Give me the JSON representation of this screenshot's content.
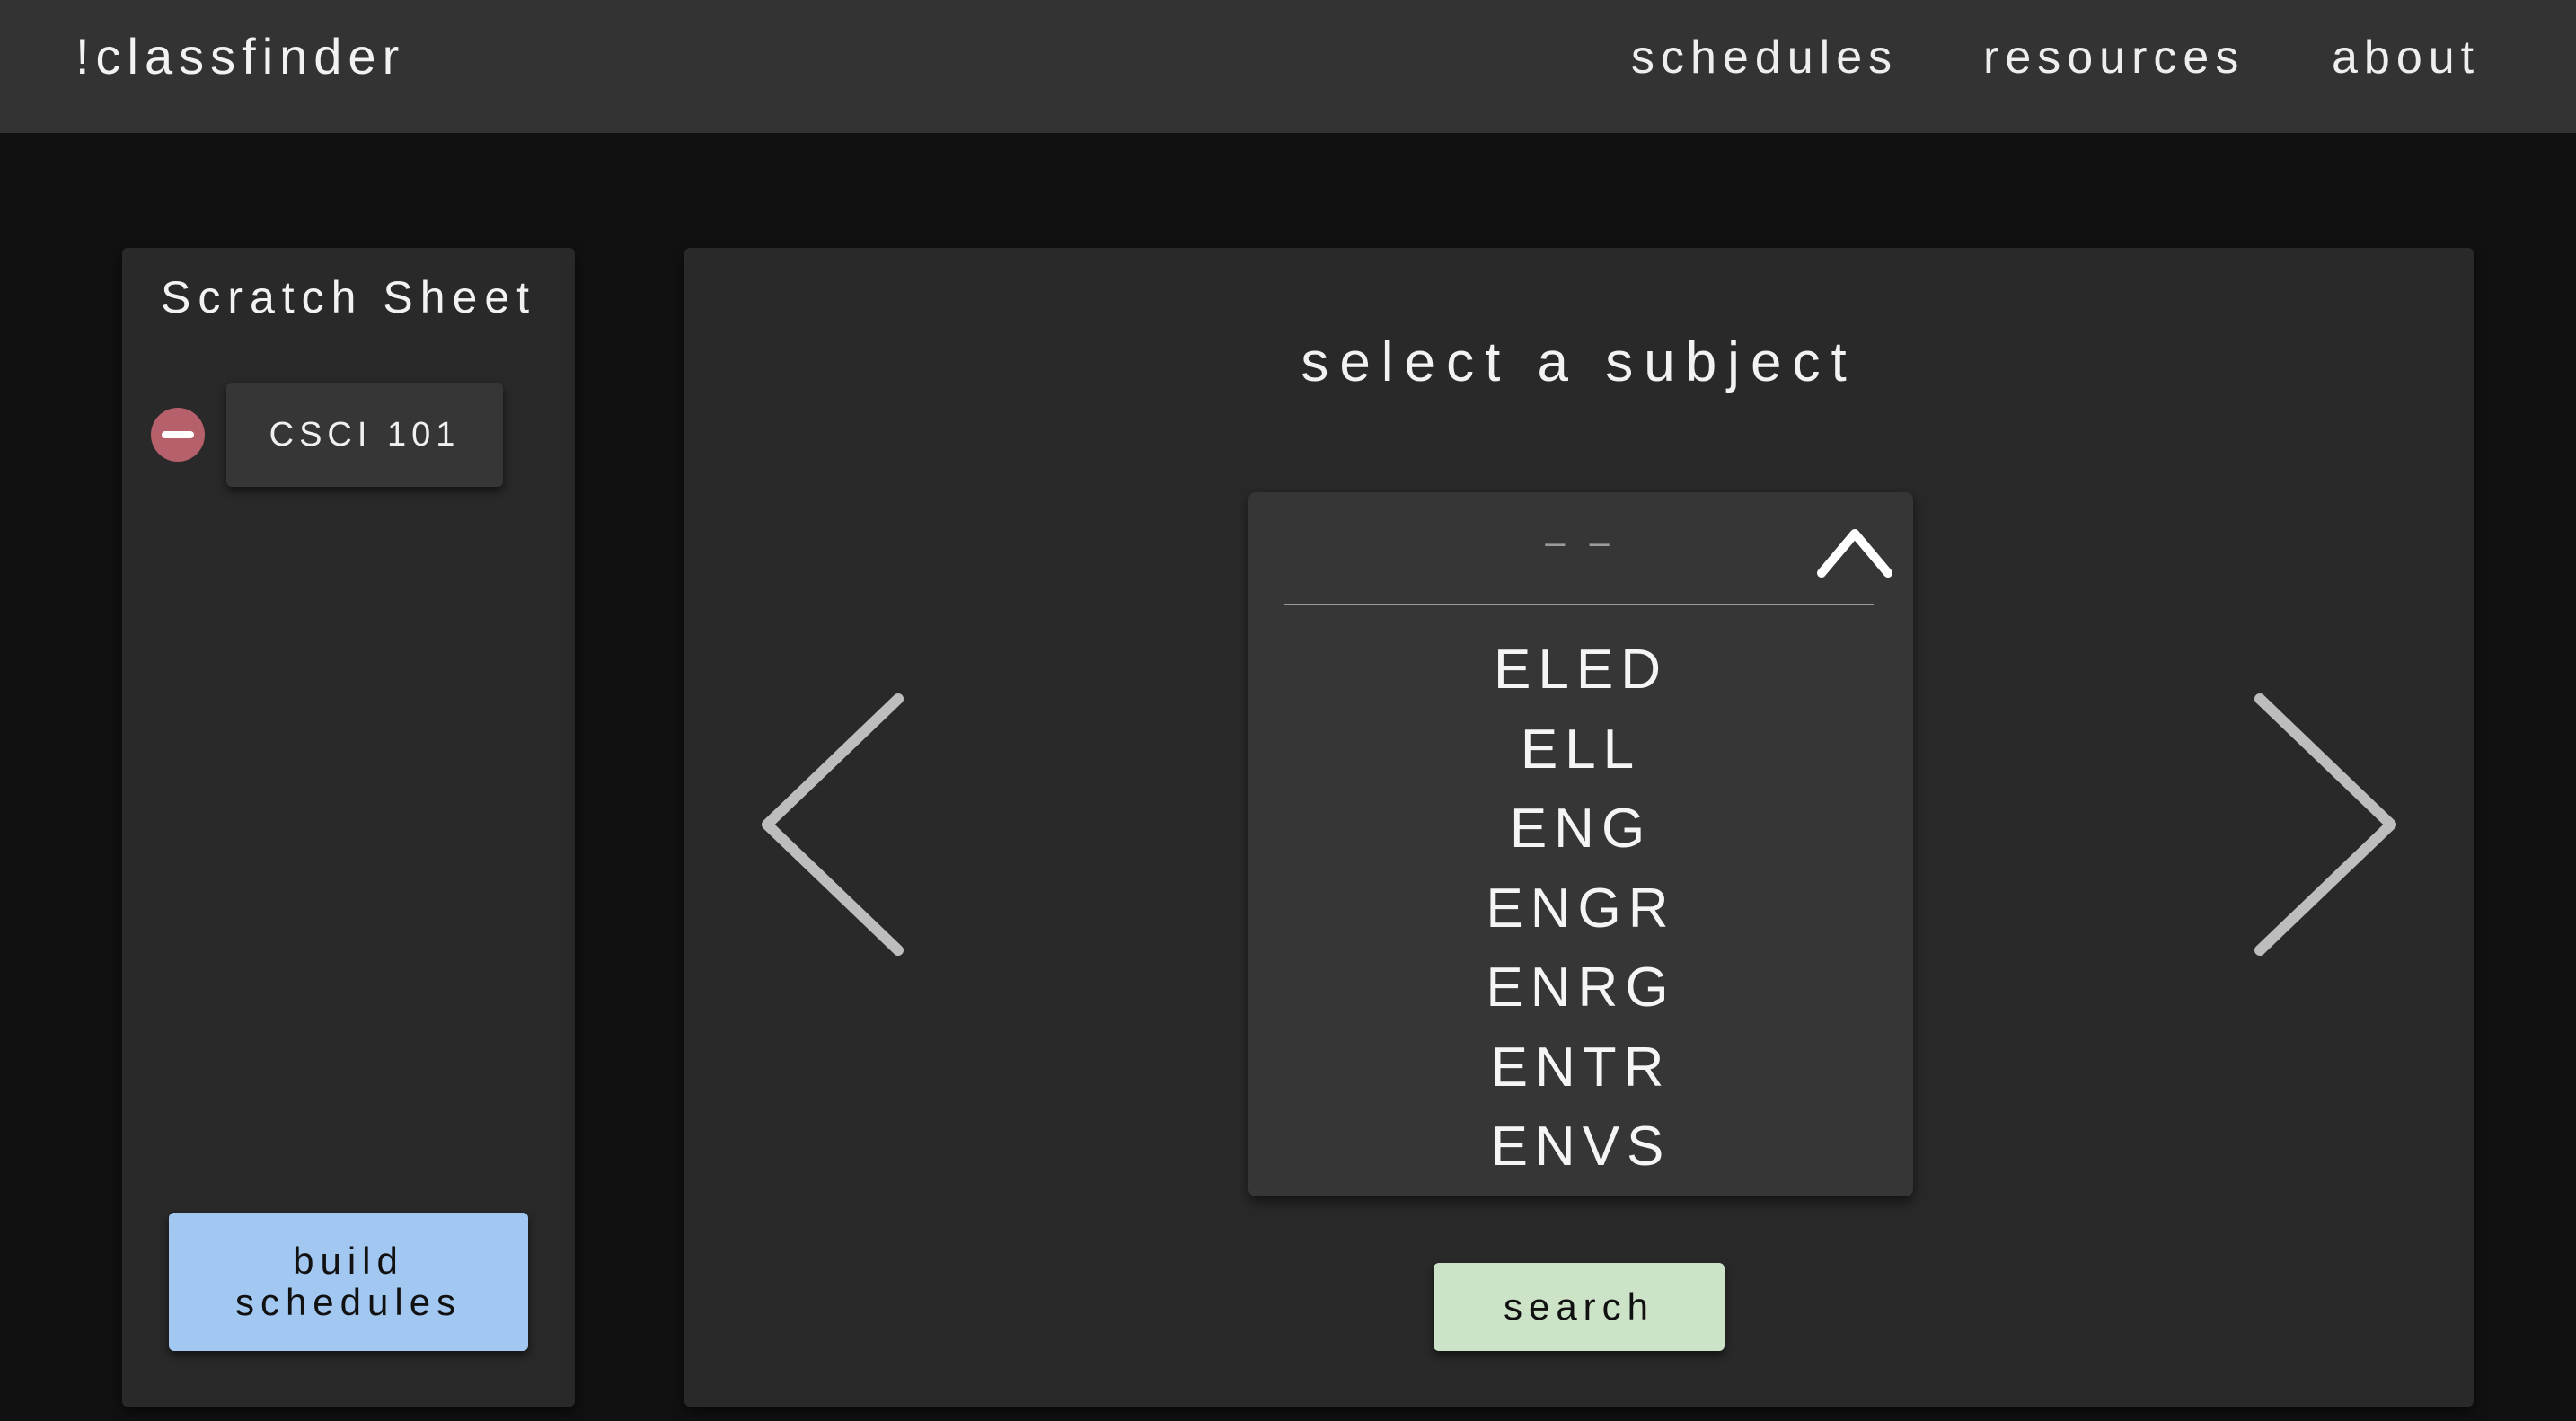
{
  "header": {
    "brand": "!classfinder",
    "nav": [
      "schedules",
      "resources",
      "about"
    ]
  },
  "scratch_sheet": {
    "title": "Scratch Sheet",
    "courses": [
      "CSCI 101"
    ],
    "remove_icon": "minus-circle-icon",
    "build_button": {
      "line1": "build",
      "line2": "schedules"
    }
  },
  "main": {
    "title": "select a subject",
    "dropdown": {
      "selected": "– –",
      "toggle_icon": "chevron-up-icon",
      "options": [
        "ELED",
        "ELL",
        "ENG",
        "ENGR",
        "ENRG",
        "ENTR",
        "ENVS"
      ]
    },
    "prev_icon": "chevron-left-icon",
    "next_icon": "chevron-right-icon",
    "search_label": "search"
  },
  "colors": {
    "background": "#111111",
    "topbar": "#333333",
    "panel": "#292929",
    "remove": "#b5606a",
    "build": "#a2c8f2",
    "search": "#cde3c8"
  }
}
